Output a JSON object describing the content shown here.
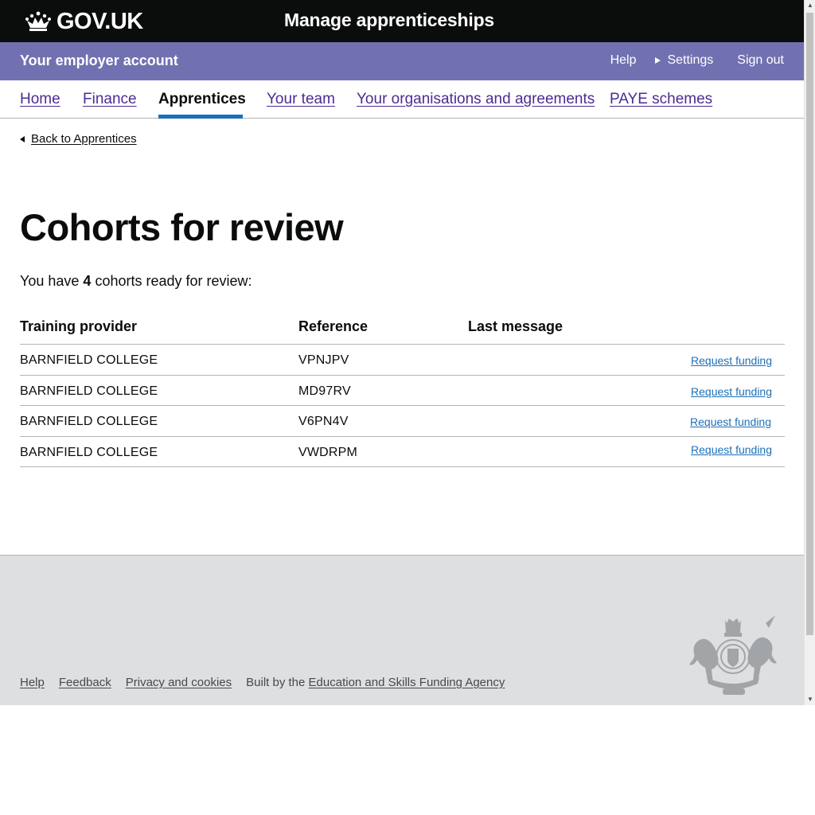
{
  "header": {
    "logotype": "GOV.UK",
    "service_name": "Manage apprenticeships"
  },
  "account_bar": {
    "title": "Your employer account",
    "help": "Help",
    "settings": "Settings",
    "sign_out": "Sign out"
  },
  "nav": {
    "items": [
      {
        "label": "Home",
        "active": false
      },
      {
        "label": "Finance",
        "active": false
      },
      {
        "label": "Apprentices",
        "active": true
      },
      {
        "label": "Your team",
        "active": false
      },
      {
        "label": "Your organisations and agreements",
        "active": false
      },
      {
        "label": "PAYE schemes",
        "active": false
      }
    ]
  },
  "back_link": "Back to Apprentices",
  "page_title": "Cohorts for review",
  "summary": {
    "prefix": "You have ",
    "count": "4",
    "suffix": " cohorts ready for review:"
  },
  "table": {
    "headers": [
      "Training provider",
      "Reference",
      "Last message"
    ],
    "rows": [
      {
        "provider": "BARNFIELD COLLEGE",
        "reference": "VPNJPV",
        "last_message": "",
        "action": "Request funding"
      },
      {
        "provider": "BARNFIELD COLLEGE",
        "reference": "MD97RV",
        "last_message": "",
        "action": "Request funding"
      },
      {
        "provider": "BARNFIELD COLLEGE",
        "reference": "V6PN4V",
        "last_message": "",
        "action": "Request funding"
      },
      {
        "provider": "BARNFIELD COLLEGE",
        "reference": "VWDRPM",
        "last_message": "",
        "action": "Request funding"
      }
    ]
  },
  "footer": {
    "links": [
      "Help",
      "Feedback",
      "Privacy and cookies"
    ],
    "built_by_prefix": "Built by the ",
    "built_by_link": "Education and Skills Funding Agency",
    "crest_icon": "royal-coat-of-arms-icon"
  },
  "colors": {
    "header_bg": "#0b0c0c",
    "account_bar_bg": "#7171b2",
    "nav_link": "#4c2c92",
    "active_underline": "#1d70b8",
    "action_link": "#1d70b8",
    "footer_bg": "#dedfe0"
  }
}
